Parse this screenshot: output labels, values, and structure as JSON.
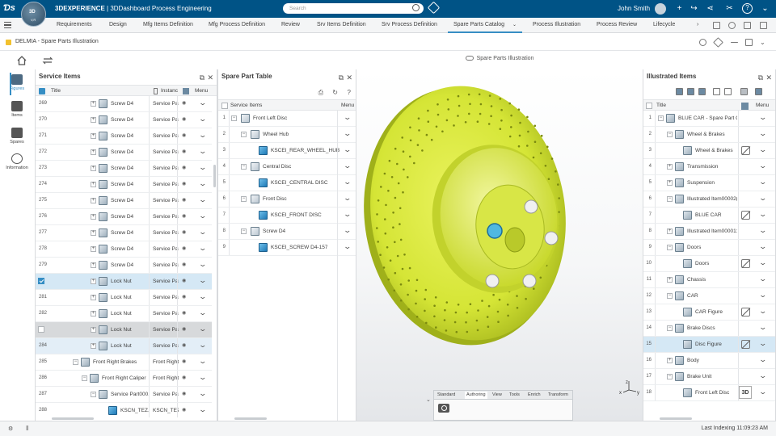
{
  "topbar": {
    "brand_prefix": "3DEXPERIENCE",
    "brand_rest": " | 3DDashboard  Process Engineering",
    "compass_label": "3D",
    "compass_sub": "V,R",
    "search_placeholder": "Search",
    "user": "John Smith"
  },
  "tabs": [
    {
      "label": "Requirements"
    },
    {
      "label": "Design"
    },
    {
      "label": "Mfg Items Definition"
    },
    {
      "label": "Mfg Process Definition"
    },
    {
      "label": "Review"
    },
    {
      "label": "Srv Items Definition"
    },
    {
      "label": "Srv Process Definition"
    },
    {
      "label": "Spare Parts Catalog"
    },
    {
      "label": "Process Illustration"
    },
    {
      "label": "Process Review"
    },
    {
      "label": "Lifecycle"
    }
  ],
  "active_tab": "Spare Parts Catalog",
  "dashboard_title": "DELMIA - Spare Parts Illustration",
  "view_title": "Spare Parts Illustration",
  "rail": [
    {
      "label": "Figures"
    },
    {
      "label": "Items"
    },
    {
      "label": "Spares"
    },
    {
      "label": "Information"
    }
  ],
  "service_items": {
    "title": "Service Items",
    "col_title": "Title",
    "col_instance": "Instanc",
    "col_menu": "Menu",
    "rows": [
      {
        "num": "269",
        "title": "Screw D4",
        "instance": "Service Par",
        "level": 3,
        "expand": "+",
        "state": ""
      },
      {
        "num": "270",
        "title": "Screw D4",
        "instance": "Service Par",
        "level": 3,
        "expand": "+",
        "state": ""
      },
      {
        "num": "271",
        "title": "Screw D4",
        "instance": "Service Par",
        "level": 3,
        "expand": "+",
        "state": ""
      },
      {
        "num": "272",
        "title": "Screw D4",
        "instance": "Service Par",
        "level": 3,
        "expand": "+",
        "state": ""
      },
      {
        "num": "273",
        "title": "Screw D4",
        "instance": "Service Par",
        "level": 3,
        "expand": "+",
        "state": ""
      },
      {
        "num": "274",
        "title": "Screw D4",
        "instance": "Service Par",
        "level": 3,
        "expand": "+",
        "state": ""
      },
      {
        "num": "275",
        "title": "Screw D4",
        "instance": "Service Par",
        "level": 3,
        "expand": "+",
        "state": ""
      },
      {
        "num": "276",
        "title": "Screw D4",
        "instance": "Service Par",
        "level": 3,
        "expand": "+",
        "state": ""
      },
      {
        "num": "277",
        "title": "Screw D4",
        "instance": "Service Par",
        "level": 3,
        "expand": "+",
        "state": ""
      },
      {
        "num": "278",
        "title": "Screw D4",
        "instance": "Service Par",
        "level": 3,
        "expand": "+",
        "state": ""
      },
      {
        "num": "279",
        "title": "Screw D4",
        "instance": "Service Par",
        "level": 3,
        "expand": "+",
        "state": ""
      },
      {
        "num": "",
        "title": "Lock Nut",
        "instance": "Service Par",
        "level": 3,
        "expand": "+",
        "state": "selected"
      },
      {
        "num": "281",
        "title": "Lock Nut",
        "instance": "Service Par",
        "level": 3,
        "expand": "+",
        "state": ""
      },
      {
        "num": "282",
        "title": "Lock Nut",
        "instance": "Service Par",
        "level": 3,
        "expand": "+",
        "state": ""
      },
      {
        "num": "",
        "title": "Lock Nut",
        "instance": "Service Par",
        "level": 3,
        "expand": "+",
        "state": "hover"
      },
      {
        "num": "284",
        "title": "Lock Nut",
        "instance": "Service Par",
        "level": 3,
        "expand": "+",
        "state": "light"
      },
      {
        "num": "285",
        "title": "Front Right Brakes",
        "instance": "Front Right",
        "level": 1,
        "expand": "−",
        "state": ""
      },
      {
        "num": "286",
        "title": "Front Right Caliper",
        "instance": "Front Right",
        "level": 2,
        "expand": "−",
        "state": ""
      },
      {
        "num": "287",
        "title": "Service Part000...",
        "instance": "Service Par",
        "level": 3,
        "expand": "−",
        "state": ""
      },
      {
        "num": "288",
        "title": "KSCN_TEZ...",
        "instance": "KSCN_TEZ",
        "level": 4,
        "expand": "",
        "state": ""
      }
    ]
  },
  "spare_table": {
    "title": "Spare Part Table",
    "col_items": "Service Items",
    "col_menu": "Menu",
    "rows": [
      {
        "num": "1",
        "title": "Front Left Disc",
        "level": 0,
        "expand": "−",
        "blue": false
      },
      {
        "num": "2",
        "title": "Wheel Hub",
        "level": 1,
        "expand": "−",
        "blue": false
      },
      {
        "num": "3",
        "title": "KSCEI_REAR_WHEEL_HUB",
        "level": 2,
        "expand": "",
        "blue": true
      },
      {
        "num": "4",
        "title": "Central Disc",
        "level": 1,
        "expand": "−",
        "blue": false
      },
      {
        "num": "5",
        "title": "KSCEI_CENTRAL DISC",
        "level": 2,
        "expand": "",
        "blue": true
      },
      {
        "num": "6",
        "title": "Front Disc",
        "level": 1,
        "expand": "−",
        "blue": false
      },
      {
        "num": "7",
        "title": "KSCEI_FRONT DISC",
        "level": 2,
        "expand": "",
        "blue": true
      },
      {
        "num": "8",
        "title": "Screw D4",
        "level": 1,
        "expand": "−",
        "blue": false
      },
      {
        "num": "9",
        "title": "KSCEI_SCREW D4-157",
        "level": 2,
        "expand": "",
        "blue": true
      }
    ]
  },
  "illustrated": {
    "title": "Illustrated Items",
    "col_title": "Title",
    "col_menu": "Menu",
    "rows": [
      {
        "num": "1",
        "title": "BLUE CAR - Spare Part Ca",
        "level": 0,
        "expand": "−",
        "noimg": false,
        "state": ""
      },
      {
        "num": "2",
        "title": "Wheel & Brakes",
        "level": 1,
        "expand": "−",
        "noimg": false,
        "state": ""
      },
      {
        "num": "3",
        "title": "Wheel & Brakes",
        "level": 2,
        "expand": "",
        "noimg": true,
        "state": ""
      },
      {
        "num": "4",
        "title": "Transmission",
        "level": 1,
        "expand": "+",
        "noimg": false,
        "state": ""
      },
      {
        "num": "5",
        "title": "Suspension",
        "level": 1,
        "expand": "+",
        "noimg": false,
        "state": ""
      },
      {
        "num": "6",
        "title": "Illustrated Item00002(",
        "level": 1,
        "expand": "−",
        "noimg": false,
        "state": ""
      },
      {
        "num": "7",
        "title": "BLUE CAR",
        "level": 2,
        "expand": "",
        "noimg": true,
        "state": ""
      },
      {
        "num": "8",
        "title": "Illustrated Item00001:",
        "level": 1,
        "expand": "+",
        "noimg": false,
        "state": ""
      },
      {
        "num": "9",
        "title": "Doors",
        "level": 1,
        "expand": "−",
        "noimg": false,
        "state": ""
      },
      {
        "num": "10",
        "title": "Doors",
        "level": 2,
        "expand": "",
        "noimg": true,
        "state": ""
      },
      {
        "num": "11",
        "title": "Chassis",
        "level": 1,
        "expand": "+",
        "noimg": false,
        "state": ""
      },
      {
        "num": "12",
        "title": "CAR",
        "level": 1,
        "expand": "−",
        "noimg": false,
        "state": ""
      },
      {
        "num": "13",
        "title": "CAR Figure",
        "level": 2,
        "expand": "",
        "noimg": true,
        "state": ""
      },
      {
        "num": "14",
        "title": "Brake Discs",
        "level": 1,
        "expand": "−",
        "noimg": false,
        "state": ""
      },
      {
        "num": "15",
        "title": "Disc Figure",
        "level": 2,
        "expand": "",
        "noimg": true,
        "state": "selected"
      },
      {
        "num": "16",
        "title": "Body",
        "level": 1,
        "expand": "+",
        "noimg": false,
        "state": ""
      },
      {
        "num": "17",
        "title": "Brake Unit",
        "level": 1,
        "expand": "−",
        "noimg": false,
        "state": ""
      },
      {
        "num": "18",
        "title": "Front Left Disc",
        "level": 2,
        "expand": "",
        "noimg": false,
        "state": "",
        "badge": "3D"
      }
    ]
  },
  "action_tabs": [
    "Standard",
    "Authoring",
    "View",
    "Tools",
    "Enrich",
    "Transform"
  ],
  "status": "Last Indexing  11:09:23 AM",
  "axes": {
    "x": "x",
    "y": "y",
    "z": "z"
  },
  "colors": {
    "accent": "#368ec4",
    "topbar": "#005386",
    "disc": "#d7e83a"
  }
}
